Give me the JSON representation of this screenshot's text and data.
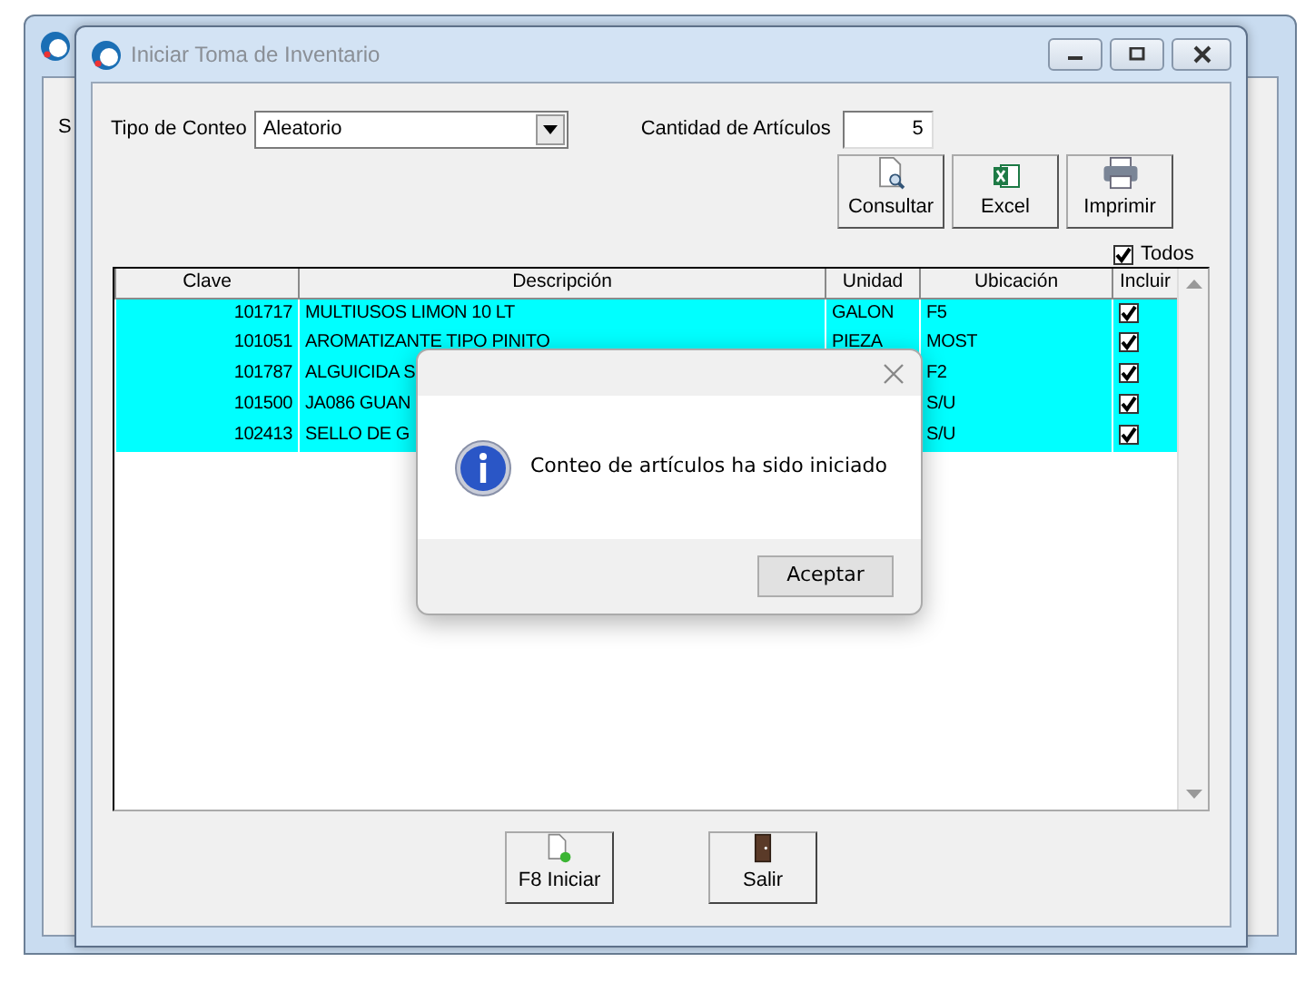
{
  "background_window": {
    "label": "S"
  },
  "window": {
    "title": "Iniciar Toma de Inventario"
  },
  "filters": {
    "count_type_label": "Tipo de Conteo",
    "count_type_value": "Aleatorio",
    "quantity_label": "Cantidad de Artículos",
    "quantity_value": "5"
  },
  "toolbar": [
    {
      "kind": "consult",
      "label": "Consultar"
    },
    {
      "kind": "excel",
      "label": "Excel"
    },
    {
      "kind": "print",
      "label": "Imprimir"
    }
  ],
  "select_all": {
    "label": "Todos",
    "checked": true
  },
  "table": {
    "columns": [
      "Clave",
      "Descripción",
      "Unidad",
      "Ubicación",
      "Incluir"
    ],
    "rows": [
      {
        "clave": "101717",
        "descripcion": "MULTIUSOS LIMON 10 LT",
        "unidad": "GALON",
        "ubicacion": "F5",
        "checked": true
      },
      {
        "clave": "101051",
        "descripcion": "AROMATIZANTE TIPO PINITO",
        "unidad": "PIEZA",
        "ubicacion": "MOST",
        "checked": true
      },
      {
        "clave": "101787",
        "descripcion": "ALGUICIDA S",
        "ubicacion": "F2",
        "checked": true
      },
      {
        "clave": "101500",
        "descripcion": "JA086 GUAN",
        "ubicacion": "S/U",
        "checked": true
      },
      {
        "clave": "102413",
        "descripcion": "SELLO DE G",
        "ubicacion": "S/U",
        "checked": true
      }
    ]
  },
  "bottom_buttons": [
    {
      "kind": "start",
      "label": "F8 Iniciar"
    },
    {
      "kind": "exit",
      "label": "Salir"
    }
  ],
  "dialog": {
    "message": "Conteo de artículos ha sido iniciado",
    "button": "Aceptar"
  }
}
